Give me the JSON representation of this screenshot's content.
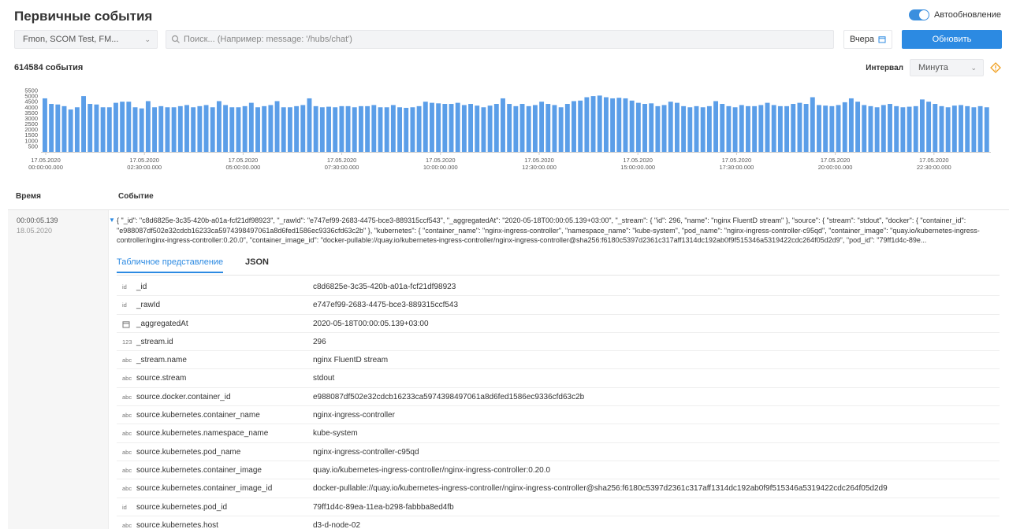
{
  "page_title": "Первичные события",
  "auto_refresh_label": "Автообновление",
  "toolbar": {
    "source_value": "Fmon, SCOM Test, FM...",
    "search_placeholder": "Поиск... (Например: message: '/hubs/chat')",
    "date_label": "Вчера",
    "refresh_label": "Обновить"
  },
  "stats": {
    "count_label": "614584 события"
  },
  "interval": {
    "label": "Интервал",
    "value": "Минута"
  },
  "chart_data": {
    "type": "bar",
    "ylim": [
      0,
      5500
    ],
    "y_ticks": [
      500,
      1000,
      1500,
      2000,
      2500,
      3000,
      3500,
      4000,
      4500,
      5000,
      5500
    ],
    "x_ticks": [
      {
        "date": "17.05.2020",
        "time": "00:00:00.000"
      },
      {
        "date": "17.05.2020",
        "time": "02:30:00.000"
      },
      {
        "date": "17.05.2020",
        "time": "05:00:00.000"
      },
      {
        "date": "17.05.2020",
        "time": "07:30:00.000"
      },
      {
        "date": "17.05.2020",
        "time": "10:00:00.000"
      },
      {
        "date": "17.05.2020",
        "time": "12:30:00.000"
      },
      {
        "date": "17.05.2020",
        "time": "15:00:00.000"
      },
      {
        "date": "17.05.2020",
        "time": "17:30:00.000"
      },
      {
        "date": "17.05.2020",
        "time": "20:00:00.000"
      },
      {
        "date": "17.05.2020",
        "time": "22:30:00.000"
      }
    ],
    "values": [
      4800,
      4300,
      4250,
      4100,
      3800,
      4000,
      5000,
      4300,
      4250,
      4000,
      4000,
      4400,
      4500,
      4500,
      4000,
      3900,
      4550,
      4000,
      4100,
      4000,
      4000,
      4100,
      4200,
      4000,
      4100,
      4200,
      4000,
      4550,
      4200,
      4000,
      4000,
      4100,
      4400,
      4000,
      4100,
      4200,
      4550,
      4000,
      4000,
      4100,
      4200,
      4800,
      4100,
      4000,
      4050,
      4000,
      4100,
      4100,
      4000,
      4100,
      4100,
      4200,
      4000,
      4000,
      4200,
      4000,
      3950,
      4000,
      4100,
      4500,
      4400,
      4350,
      4300,
      4300,
      4400,
      4200,
      4300,
      4150,
      4000,
      4150,
      4300,
      4800,
      4300,
      4100,
      4300,
      4100,
      4200,
      4500,
      4300,
      4200,
      4000,
      4300,
      4550,
      4600,
      4900,
      5000,
      5050,
      4900,
      4800,
      4850,
      4800,
      4600,
      4400,
      4300,
      4350,
      4100,
      4200,
      4500,
      4400,
      4100,
      4000,
      4100,
      4000,
      4100,
      4550,
      4300,
      4100,
      4000,
      4200,
      4100,
      4100,
      4200,
      4400,
      4200,
      4100,
      4100,
      4300,
      4400,
      4300,
      4900,
      4200,
      4150,
      4100,
      4200,
      4450,
      4800,
      4500,
      4200,
      4100,
      4000,
      4200,
      4300,
      4100,
      4000,
      4050,
      4100,
      4700,
      4500,
      4300,
      4100,
      4000,
      4150,
      4200,
      4100,
      4000,
      4100,
      4000
    ]
  },
  "table": {
    "col_time": "Время",
    "col_event": "Событие"
  },
  "event": {
    "time": "00:00:05.139",
    "date": "18.05.2020",
    "text": "{ \"_id\": \"c8d6825e-3c35-420b-a01a-fcf21df98923\", \"_rawId\": \"e747ef99-2683-4475-bce3-889315ccf543\", \"_aggregatedAt\": \"2020-05-18T00:00:05.139+03:00\", \"_stream\": { \"id\": 296, \"name\": \"nginx FluentD stream\" }, \"source\": { \"stream\": \"stdout\", \"docker\": { \"container_id\": \"e988087df502e32cdcb16233ca5974398497061a8d6fed1586ec9336cfd63c2b\" }, \"kubernetes\": { \"container_name\": \"nginx-ingress-controller\", \"namespace_name\": \"kube-system\", \"pod_name\": \"nginx-ingress-controller-c95qd\", \"container_image\": \"quay.io/kubernetes-ingress-controller/nginx-ingress-controller:0.20.0\", \"container_image_id\": \"docker-pullable://quay.io/kubernetes-ingress-controller/nginx-ingress-controller@sha256:f6180c5397d2361c317aff1314dc192ab0f9f515346a5319422cdc264f05d2d9\", \"pod_id\": \"79ff1d4c-89e..."
  },
  "tabs": {
    "table_view": "Табличное представление",
    "json": "JSON"
  },
  "fields": [
    {
      "type": "id",
      "name": "_id",
      "value": "c8d6825e-3c35-420b-a01a-fcf21df98923"
    },
    {
      "type": "id",
      "name": "_rawId",
      "value": "e747ef99-2683-4475-bce3-889315ccf543"
    },
    {
      "type": "calendar-icon",
      "name": "_aggregatedAt",
      "value": "2020-05-18T00:00:05.139+03:00"
    },
    {
      "type": "123",
      "name": "_stream.id",
      "value": "296"
    },
    {
      "type": "abc",
      "name": "_stream.name",
      "value": "nginx FluentD stream"
    },
    {
      "type": "abc",
      "name": "source.stream",
      "value": "stdout"
    },
    {
      "type": "abc",
      "name": "source.docker.container_id",
      "value": "e988087df502e32cdcb16233ca5974398497061a8d6fed1586ec9336cfd63c2b"
    },
    {
      "type": "abc",
      "name": "source.kubernetes.container_name",
      "value": "nginx-ingress-controller"
    },
    {
      "type": "abc",
      "name": "source.kubernetes.namespace_name",
      "value": "kube-system"
    },
    {
      "type": "abc",
      "name": "source.kubernetes.pod_name",
      "value": "nginx-ingress-controller-c95qd"
    },
    {
      "type": "abc",
      "name": "source.kubernetes.container_image",
      "value": "quay.io/kubernetes-ingress-controller/nginx-ingress-controller:0.20.0"
    },
    {
      "type": "abc",
      "name": "source.kubernetes.container_image_id",
      "value": "docker-pullable://quay.io/kubernetes-ingress-controller/nginx-ingress-controller@sha256:f6180c5397d2361c317aff1314dc192ab0f9f515346a5319422cdc264f05d2d9"
    },
    {
      "type": "id",
      "name": "source.kubernetes.pod_id",
      "value": "79ff1d4c-89ea-11ea-b298-fabbba8ed4fb"
    },
    {
      "type": "abc",
      "name": "source.kubernetes.host",
      "value": "d3-d-node-02"
    }
  ],
  "colors": {
    "accent": "#2c8ae2",
    "bar": "#5b9ee8"
  }
}
